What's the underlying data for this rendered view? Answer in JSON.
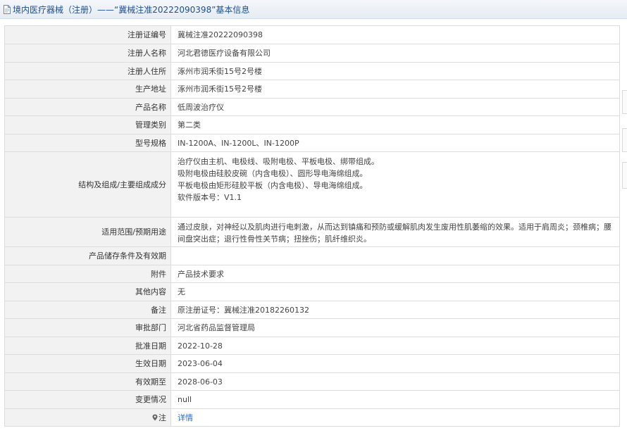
{
  "page": {
    "title": "境内医疗器械（注册）——“冀械注准20222090398”基本信息"
  },
  "fields": {
    "reg_no": {
      "label": "注册证编号",
      "value": "冀械注准20222090398"
    },
    "registrant": {
      "label": "注册人名称",
      "value": "河北君德医疗设备有限公司"
    },
    "registrant_address": {
      "label": "注册人住所",
      "value": "涿州市润禾街15号2号楼"
    },
    "production_address": {
      "label": "生产地址",
      "value": "涿州市润禾街15号2号楼"
    },
    "product_name": {
      "label": "产品名称",
      "value": "低周波治疗仪"
    },
    "category": {
      "label": "管理类别",
      "value": "第二类"
    },
    "model": {
      "label": "型号规格",
      "value": "IN-1200A、IN-1200L、IN-1200P"
    },
    "structure": {
      "label": "结构及组成/主要组成成分",
      "lines": [
        "治疗仪由主机、电极线、吸附电极、平板电极、绑带组成。",
        "吸附电极由硅胶皮碗（内含电极）、圆形导电海绵组成。",
        "平板电极由矩形硅胶平板（内含电极）、导电海绵组成。",
        "软件版本号：V1.1"
      ]
    },
    "scope": {
      "label": "适用范围/预期用途",
      "value": "通过皮肤，对神经以及肌肉进行电刺激，从而达到镇痛和预防或缓解肌肉发生废用性肌萎缩的效果。适用于肩周炎；颈椎病；腰间盘突出症；退行性骨性关节病；扭挫伤；肌纤维织炎。"
    },
    "storage": {
      "label": "产品储存条件及有效期",
      "value": ""
    },
    "accessories": {
      "label": "附件",
      "value": "产品技术要求"
    },
    "other": {
      "label": "其他内容",
      "value": "无"
    },
    "remarks": {
      "label": "备注",
      "value": "原注册证号：冀械注准20182260132"
    },
    "approval_dept": {
      "label": "审批部门",
      "value": "河北省药品监督管理局"
    },
    "approval_date": {
      "label": "批准日期",
      "value": "2022-10-28"
    },
    "effective_date": {
      "label": "生效日期",
      "value": "2023-06-04"
    },
    "valid_until": {
      "label": "有效期至",
      "value": "2028-06-03"
    },
    "changes": {
      "label": "变更情况",
      "value": "null"
    },
    "note": {
      "label": "注",
      "link": "详情"
    }
  },
  "icons": {
    "title": "document-icon",
    "note": "map-pin-icon"
  },
  "colors": {
    "title_text": "#1f4e8c",
    "label_bg": "#f2f2f2",
    "border": "#dcdcdc",
    "link": "#2a6ac8"
  }
}
